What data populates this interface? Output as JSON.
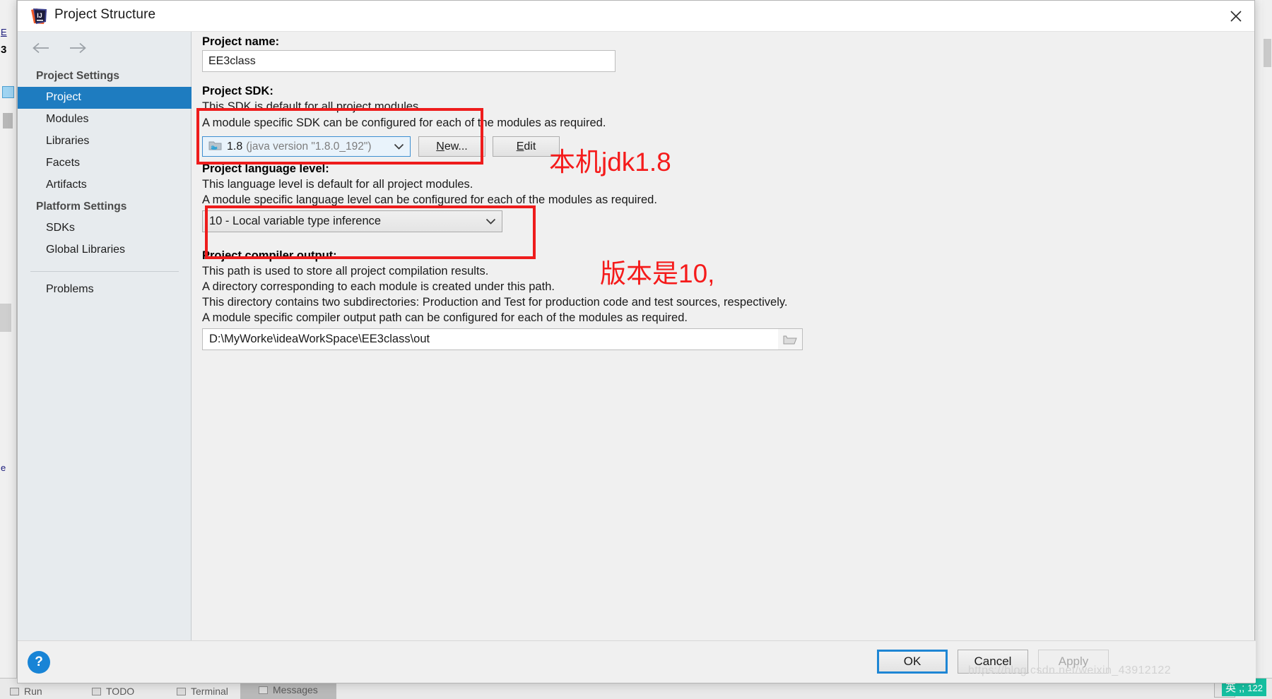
{
  "window": {
    "title": "Project Structure",
    "logo_icon": "intellij-idea-logo",
    "close_icon": "close-icon"
  },
  "nav": {
    "back_icon": "arrow-left-icon",
    "forward_icon": "arrow-right-icon"
  },
  "sidebar": {
    "groups": [
      {
        "label": "Project Settings",
        "items": [
          {
            "label": "Project",
            "selected": true
          },
          {
            "label": "Modules",
            "selected": false
          },
          {
            "label": "Libraries",
            "selected": false
          },
          {
            "label": "Facets",
            "selected": false
          },
          {
            "label": "Artifacts",
            "selected": false
          }
        ]
      },
      {
        "label": "Platform Settings",
        "items": [
          {
            "label": "SDKs",
            "selected": false
          },
          {
            "label": "Global Libraries",
            "selected": false
          }
        ]
      }
    ],
    "problems_label": "Problems"
  },
  "main": {
    "project_name_label": "Project name:",
    "project_name_value": "EE3class",
    "project_sdk_label": "Project SDK:",
    "sdk_desc_line1": "This SDK is default for all project modules.",
    "sdk_desc_line2": "A module specific SDK can be configured for each of the modules as required.",
    "sdk_icon": "java-sdk-icon",
    "sdk_version": "1.8",
    "sdk_detail": "(java version \"1.8.0_192\")",
    "sdk_dropdown_icon": "chevron-down-icon",
    "new_button": "New...",
    "new_button_mnemonic": "N",
    "new_button_rest": "ew...",
    "edit_button": "Edit",
    "edit_button_mnemonic": "E",
    "edit_button_rest": "dit",
    "lang_level_label": "Project language level:",
    "lang_desc_line1": "This language level is default for all project modules.",
    "lang_desc_line2": "A module specific language level can be configured for each of the modules as required.",
    "lang_level_value": "10 - Local variable type inference",
    "lang_dropdown_icon": "chevron-down-icon",
    "compiler_output_label": "Project compiler output:",
    "compiler_desc_line1": "This path is used to store all project compilation results.",
    "compiler_desc_line2": "A directory corresponding to each module is created under this path.",
    "compiler_desc_line3": "This directory contains two subdirectories: Production and Test for production code and test sources, respectively.",
    "compiler_desc_line4": "A module specific compiler output path can be configured for each of the modules as required.",
    "output_path_value": "D:\\MyWorke\\ideaWorkSpace\\EE3class\\out",
    "browse_icon": "folder-browse-icon"
  },
  "annotations": {
    "color": "#ee1c1c",
    "sdk_note": "本机jdk1.8",
    "lang_note": "版本是10,"
  },
  "footer": {
    "help_label": "?",
    "help_icon": "help-circle-icon",
    "ok_label": "OK",
    "cancel_label": "Cancel",
    "apply_label": "Apply"
  },
  "watermark": {
    "text": "https://blog.csdn.net/weixin_43912122"
  },
  "background": {
    "left_marks": [
      "E",
      "3",
      "e"
    ],
    "tabs": [
      {
        "label": "Run",
        "selected": false
      },
      {
        "label": "TODO",
        "selected": false
      },
      {
        "label": "Terminal",
        "selected": false
      },
      {
        "label": "Messages",
        "selected": true
      }
    ],
    "ime_lang": "英",
    "ime_extra": ",;",
    "ime_num": "122"
  }
}
